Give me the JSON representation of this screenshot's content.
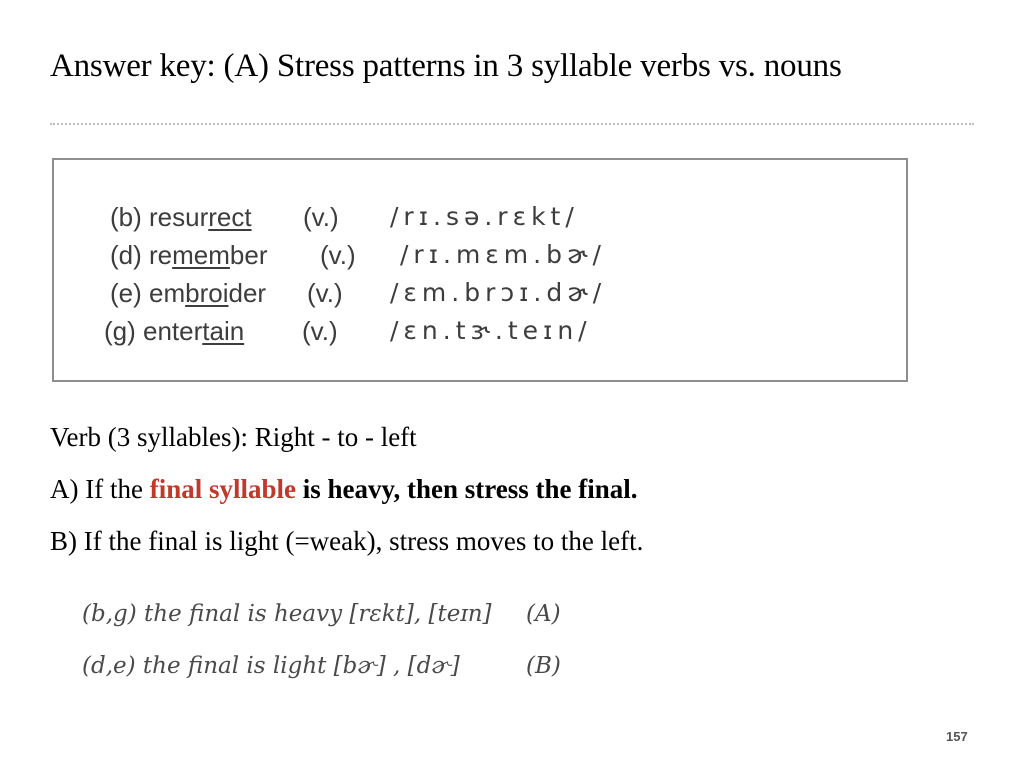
{
  "slide": {
    "title": "Answer key: (A) Stress patterns in 3 syllable verbs vs. nouns",
    "page_number": "157"
  },
  "examples": [
    {
      "pre": "(b) resur",
      "stressed": "rect",
      "post": "",
      "pos": "(v.)",
      "ipa": "/rɪ.sə.rɛkt/"
    },
    {
      "pre": "(d) re",
      "stressed": "mem",
      "post": "ber",
      "pos": "(v.)",
      "ipa": "/rɪ.mɛm.bɚ/"
    },
    {
      "pre": "(e) em",
      "stressed": "broi",
      "post": "der",
      "pos": "(v.)",
      "ipa": "/ɛm.brɔɪ.dɚ/"
    },
    {
      "pre": "(g) enter",
      "stressed": "tain",
      "post": "",
      "pos": "(v.)",
      "ipa": "/ɛn.tɝ.teɪn/"
    }
  ],
  "rules": {
    "heading": "Verb (3 syllables): Right - to - left",
    "rule_a_prefix": "A) If the ",
    "rule_a_highlight": "final syllable",
    "rule_a_suffix": " is heavy, then stress the final.",
    "rule_b": "B) If the final is light (=weak), stress moves to the left."
  },
  "notes": [
    {
      "text": "(b,g) the final is heavy [rɛkt], [teɪn]",
      "tag": "(A)"
    },
    {
      "text": "(d,e) the final is light [bɚ] , [dɚ]",
      "tag": "(B)"
    }
  ],
  "colors": {
    "highlight": "#c0392b",
    "box_border": "#8f8f8f",
    "divider": "#bdbdbd"
  }
}
